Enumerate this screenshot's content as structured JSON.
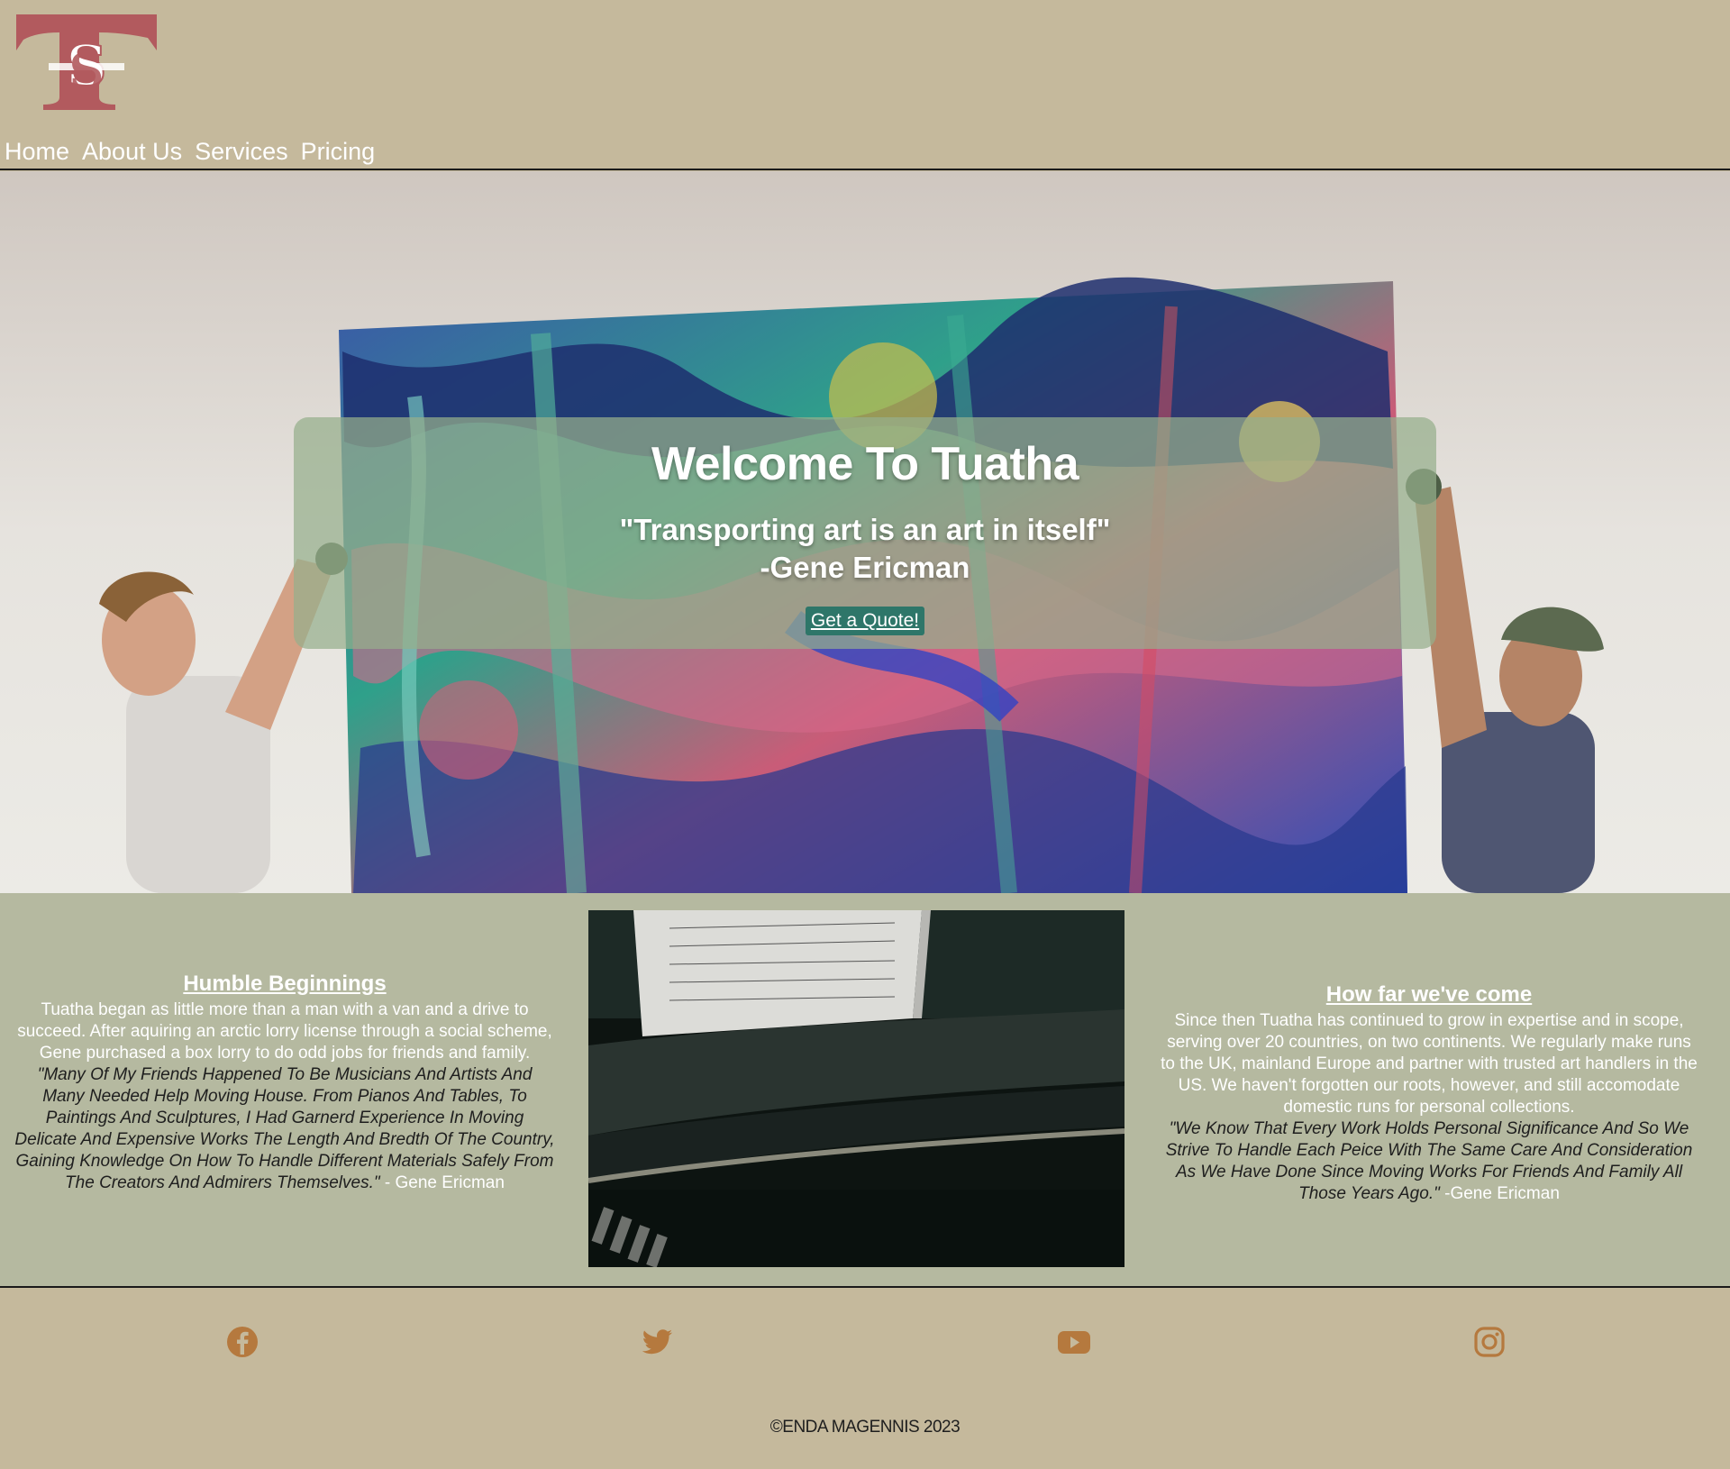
{
  "header": {
    "logo_letters": "TS",
    "nav": [
      {
        "label": "Home"
      },
      {
        "label": "About Us"
      },
      {
        "label": "Services"
      },
      {
        "label": "Pricing"
      }
    ]
  },
  "hero": {
    "title": "Welcome To Tuatha",
    "quote": "\"Transporting art is an art in itself\"",
    "quote_author": "-Gene Ericman",
    "cta_label": "Get a Quote!"
  },
  "about": {
    "left": {
      "heading": "Humble Beginnings",
      "body": "Tuatha began as little more than a man with a van and a drive to succeed. After aquiring an arctic lorry license through a social scheme, Gene purchased a box lorry to do odd jobs for friends and family.",
      "quote": "\"Many Of My Friends Happened To Be Musicians And Artists And Many Needed Help Moving House. From Pianos And Tables, To Paintings And Sculptures, I Had Garnerd Experience In Moving Delicate And Expensive Works The Length And Bredth Of The Country, Gaining Knowledge On How To Handle Different Materials Safely From The Creators And Admirers Themselves.\"",
      "attribution": " - Gene Ericman"
    },
    "right": {
      "heading": "How far we've come",
      "body": "Since then Tuatha has continued to grow in expertise and in scope, serving over 20 countries, on two continents. We regularly make runs to the UK, mainland Europe and partner with trusted art handlers in the US. We haven't forgotten our roots, however, and still accomodate domestic runs for personal collections.",
      "quote": "\"We Know That Every Work Holds Personal Significance And So We Strive To Handle Each Peice With The Same Care And Consideration As We Have Done Since Moving Works For Friends And Family All Those Years Ago.\"",
      "attribution": " -Gene Ericman"
    }
  },
  "footer": {
    "social": [
      {
        "icon": "facebook-icon"
      },
      {
        "icon": "twitter-icon"
      },
      {
        "icon": "youtube-icon"
      },
      {
        "icon": "instagram-icon"
      }
    ],
    "copyright": "©ENDA MAGENNIS 2023"
  },
  "colors": {
    "header_bg": "#c5b99c",
    "about_bg": "#b5b9a0",
    "accent_red": "#b25a5e",
    "social_icon": "#b5793e",
    "button_bg": "#2e7669"
  }
}
